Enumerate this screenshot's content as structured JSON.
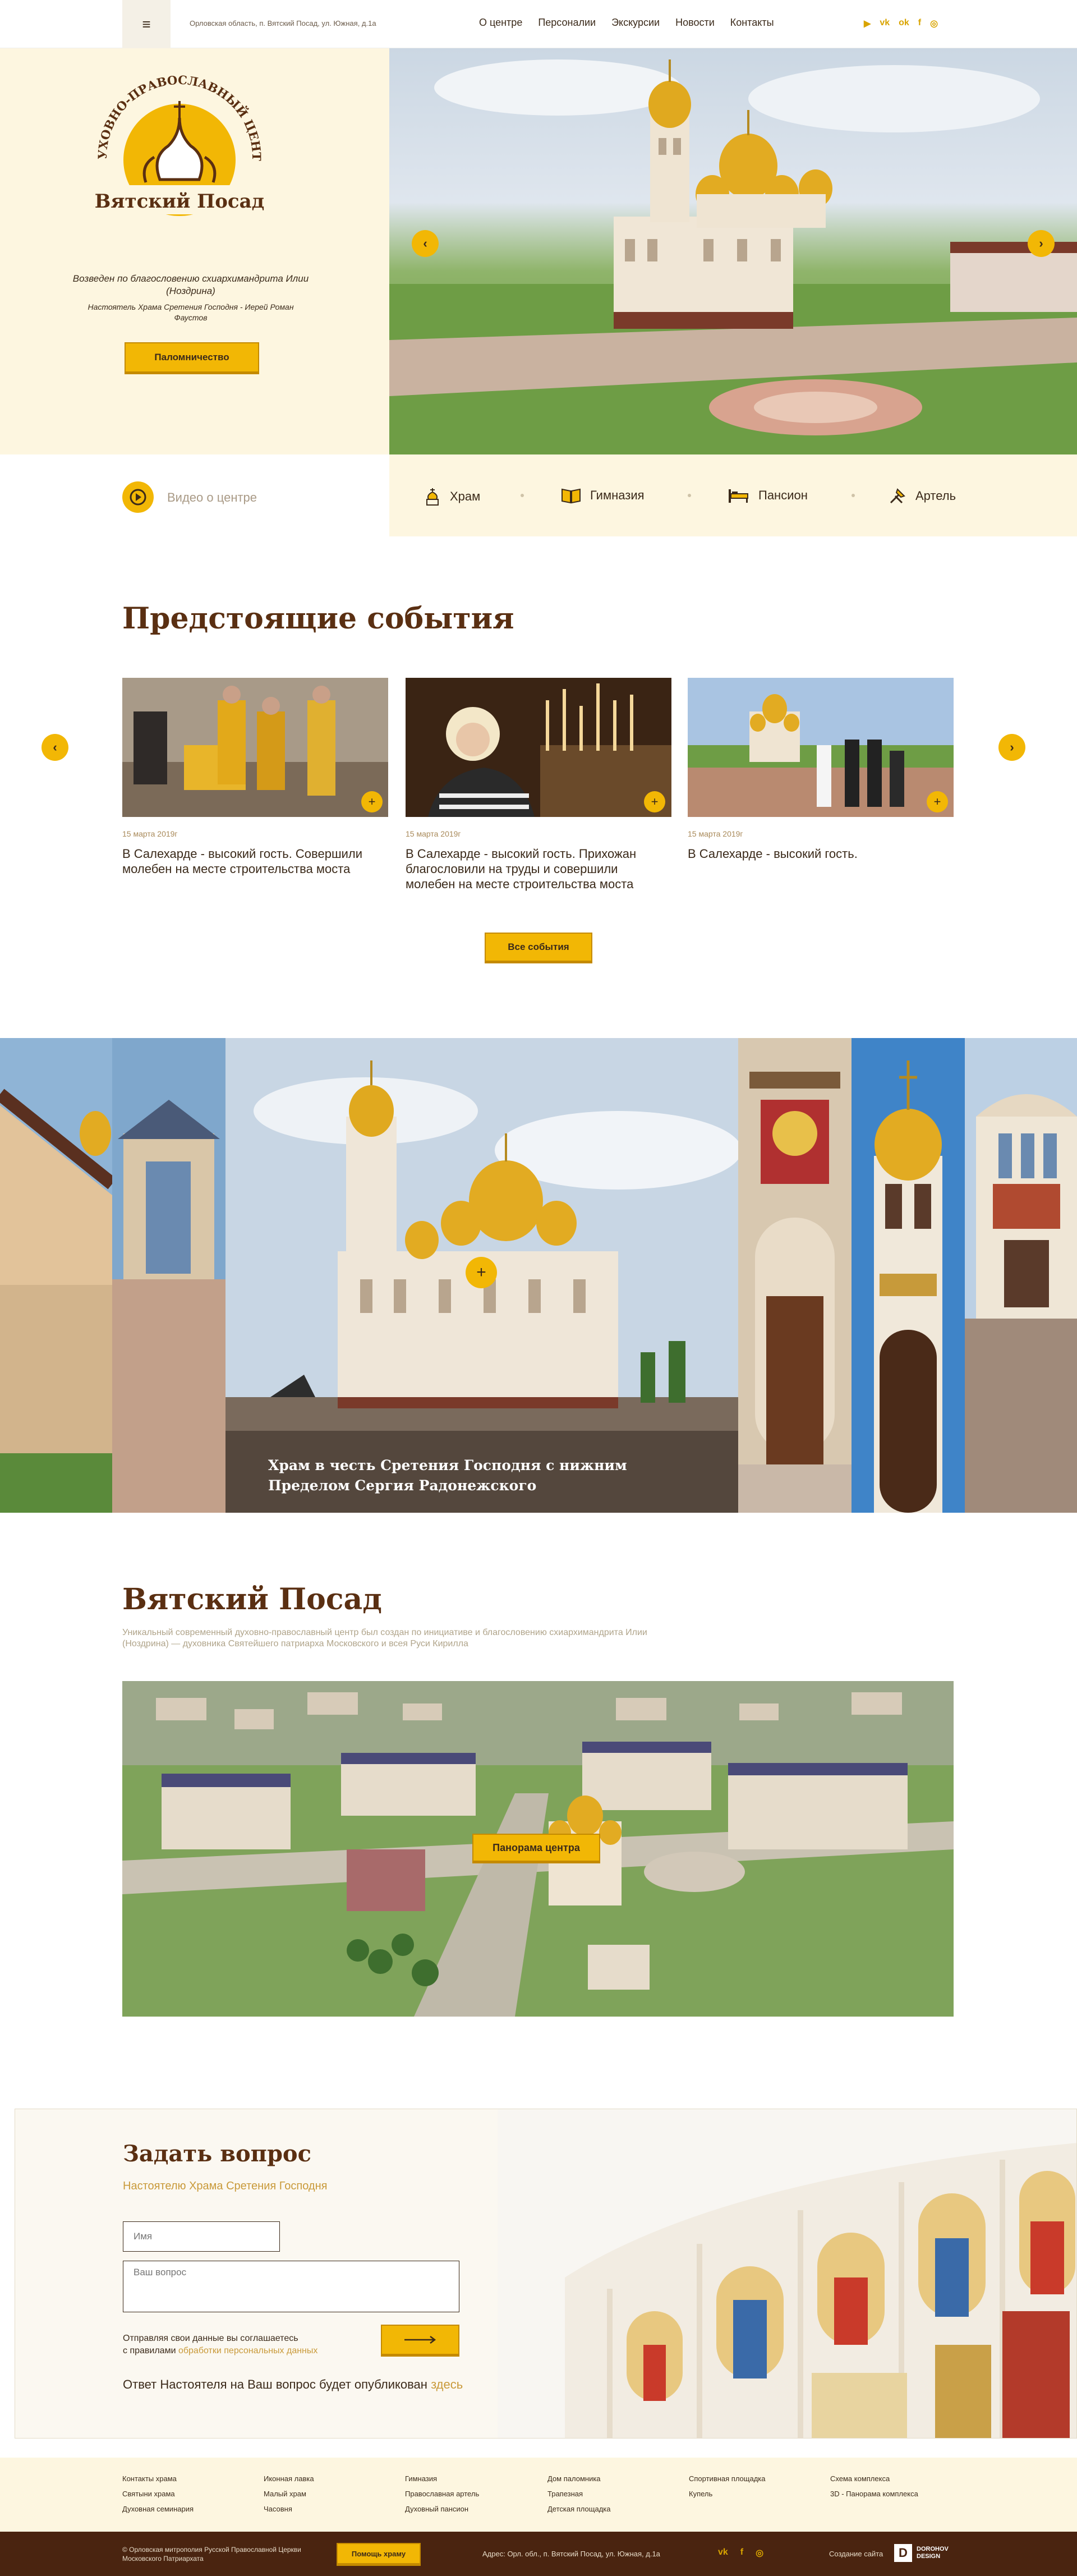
{
  "header": {
    "address": "Орловская область, п. Вятский Посад, ул. Южная, д.1а",
    "nav": [
      "О центре",
      "Персоналии",
      "Экскурсии",
      "Новости",
      "Контакты"
    ],
    "social": [
      "youtube-icon",
      "vk-icon",
      "ok-icon",
      "facebook-icon",
      "instagram-icon"
    ]
  },
  "hero": {
    "logo_arc": "ДУХОВНО-ПРАВОСЛАВНЫЙ ЦЕНТР",
    "logo_name": "Вятский Посад",
    "blessing": "Возведен по благословению схиархимандрита Илии (Ноздрина)",
    "rector": "Настоятель Храма Сретения Господня - Иерей Роман Фаустов",
    "button": "Паломничество"
  },
  "tabs": {
    "video_label": "Видео о центре",
    "items": [
      {
        "label": "Храм",
        "icon": "church-icon"
      },
      {
        "label": "Гимназия",
        "icon": "book-icon"
      },
      {
        "label": "Пансион",
        "icon": "bed-icon"
      },
      {
        "label": "Артель",
        "icon": "tools-icon"
      }
    ]
  },
  "events": {
    "title": "Предстоящие события",
    "cards": [
      {
        "date": "15 марта 2019г",
        "title": "В Салехарде - высокий гость. Совершили молебен на месте строительства моста"
      },
      {
        "date": "15 марта 2019г",
        "title": "В Салехарде - высокий гость. Прихожан благословили на труды и совершили молебен на месте строительства моста"
      },
      {
        "date": "15 марта 2019г",
        "title": "В Салехарде - высокий гость."
      }
    ],
    "all_button": "Все события"
  },
  "strip": {
    "caption": "Храм в честь Сретения Господня с нижним Пределом Сергия Радонежского"
  },
  "about": {
    "title": "Вятский Посад",
    "text": "Уникальный современный духовно-православный центр был создан по инициативе и благословению схиархимандрита Илии (Ноздрина) — духовника Святейшего патриарха Московского и всея Руси Кирилла",
    "panorama_button": "Панорама центра"
  },
  "question": {
    "title": "Задать вопрос",
    "subtitle": "Настоятелю Храма Сретения Господня",
    "name_placeholder": "Имя",
    "question_placeholder": "Ваш вопрос",
    "consent_line1": "Отправляя свои данные вы соглашаетесь",
    "consent_line2": "с правилами",
    "consent_link": "обработки персональных данных",
    "answer_text": "Ответ Настоятеля на Ваш вопрос будет опубликован",
    "answer_link": "здесь"
  },
  "footer": {
    "columns": [
      [
        "Контакты храма",
        "Святыни храма",
        "Духовная семинария"
      ],
      [
        "Иконная лавка",
        "Малый храм",
        "Часовня"
      ],
      [
        "Гимназия",
        "Православная артель",
        "Духовный пансион"
      ],
      [
        "Дом паломника",
        "Трапезная",
        "Детская площадка"
      ],
      [
        "Спортивная площадка",
        "Купель"
      ],
      [
        "Схема комплекса",
        "3D - Панорама комплекса"
      ]
    ],
    "copyright": "© Орловская митрополия Русской Православной Церкви Московского Патриархата",
    "help_button": "Помощь храму",
    "address": "Адрес: Орл. обл., п. Вятский Посад, ул. Южная, д.1а",
    "made_by": "Создание сайта",
    "studio_line1": "DOROHOV",
    "studio_line2": "DESIGN"
  }
}
